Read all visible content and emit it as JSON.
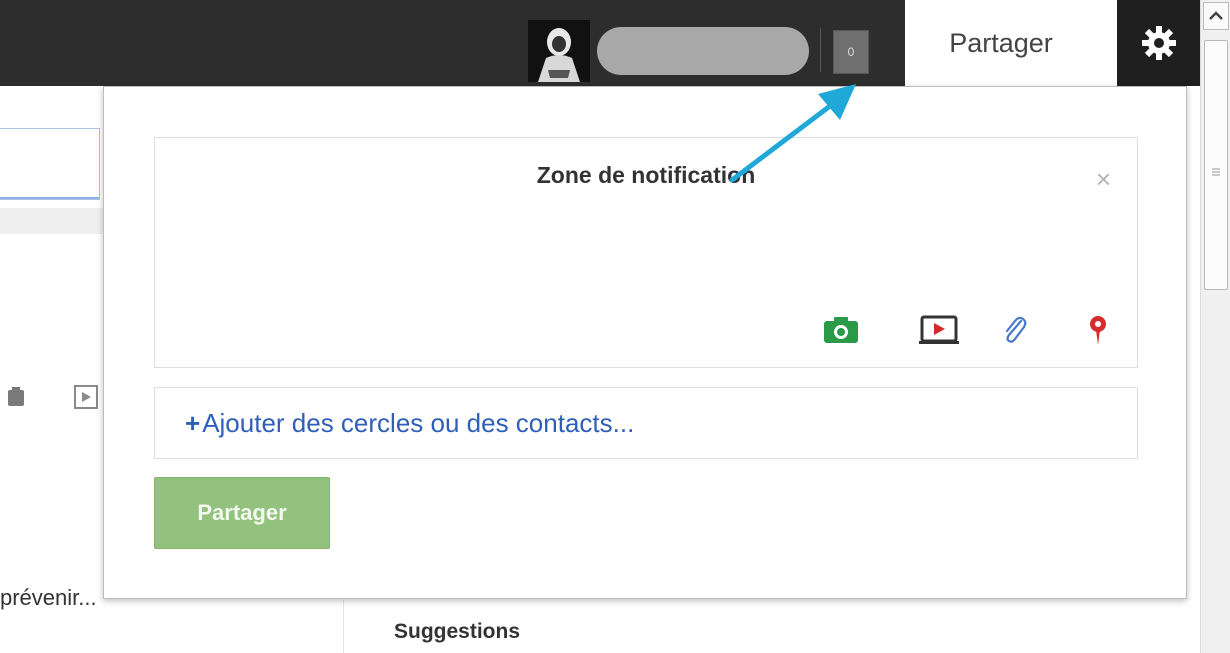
{
  "topbar": {
    "notification_count": "0",
    "share_tab_label": "Partager",
    "icons": {
      "avatar": "avatar-image",
      "gear": "gear-icon"
    }
  },
  "background_page": {
    "truncated_text": "prévenir...",
    "suggestions_heading": "Suggestions"
  },
  "popup": {
    "compose_title": "Zone de notification",
    "close_symbol": "×",
    "media_icons": [
      "camera-icon",
      "video-icon",
      "link-icon",
      "location-pin-icon"
    ],
    "recipients_plus": "+",
    "recipients_placeholder": "Ajouter des cercles ou des contacts...",
    "share_button_label": "Partager"
  },
  "colors": {
    "topbar_bg": "#2d2d2d",
    "share_button_bg": "#93c17e",
    "link_blue": "#2f5fb8",
    "arrow_cyan": "#1fa8d8",
    "camera_green": "#2a9a48",
    "video_red": "#d22a2a",
    "location_red": "#d82b2b"
  }
}
